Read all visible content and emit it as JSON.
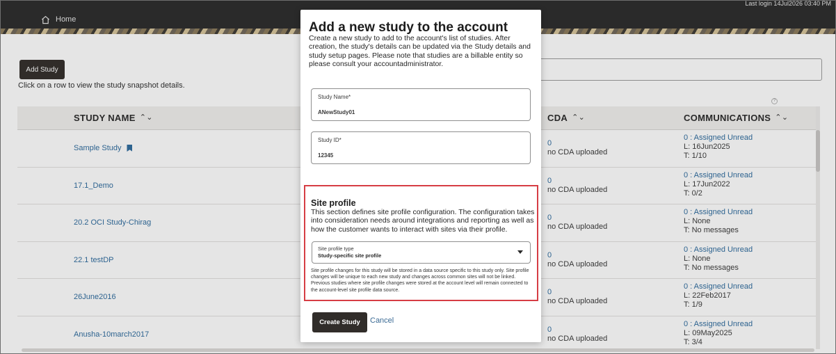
{
  "header": {
    "home_label": "Home",
    "last_login": "Last login 14Jul2026 03:40 PM"
  },
  "page": {
    "add_study_label": "Add Study",
    "hint": "Click on a row to view the study snapshot details.",
    "help": "?"
  },
  "table": {
    "columns": {
      "study_name": "STUDY NAME",
      "cda": "CDA",
      "communications": "COMMUNICATIONS"
    },
    "sort_glyph": "⌃⌄",
    "rows": [
      {
        "name": "Sample Study",
        "bookmarked": true,
        "cda_count": "0",
        "cda_text": "no CDA uploaded",
        "comm_link": "0 : Assigned Unread",
        "comm_l": "L: 16Jun2025",
        "comm_t": "T: 1/10"
      },
      {
        "name": "17.1_Demo",
        "bookmarked": false,
        "cda_count": "0",
        "cda_text": "no CDA uploaded",
        "comm_link": "0 : Assigned Unread",
        "comm_l": "L: 17Jun2022",
        "comm_t": "T: 0/2"
      },
      {
        "name": "20.2 OCI Study-Chirag",
        "bookmarked": false,
        "cda_count": "0",
        "cda_text": "no CDA uploaded",
        "comm_link": "0 : Assigned Unread",
        "comm_l": "L: None",
        "comm_t": "T: No messages"
      },
      {
        "name": "22.1 testDP",
        "bookmarked": false,
        "cda_count": "0",
        "cda_text": "no CDA uploaded",
        "comm_link": "0 : Assigned Unread",
        "comm_l": "L: None",
        "comm_t": "T: No messages"
      },
      {
        "name": "26June2016",
        "bookmarked": false,
        "cda_count": "0",
        "cda_text": "no CDA uploaded",
        "comm_link": "0 : Assigned Unread",
        "comm_l": "L: 22Feb2017",
        "comm_t": "T: 1/9"
      },
      {
        "name": "Anusha-10march2017",
        "bookmarked": false,
        "cda_count": "0",
        "cda_text": "no CDA uploaded",
        "comm_link": "0 : Assigned Unread",
        "comm_l": "L: 09May2025",
        "comm_t": "T: 3/4"
      }
    ]
  },
  "modal": {
    "title": "Add a new study to the account",
    "description": "Create a new study to add to the account's list of studies. After creation, the study's details can be updated via the Study details and study setup pages. Please note that studies are a billable entity so please consult your accountadministrator.",
    "study_name": {
      "label": "Study Name*",
      "value": "ANewStudy01"
    },
    "study_id": {
      "label": "Study ID*",
      "value": "12345"
    },
    "site_profile": {
      "title": "Site profile",
      "description": "This section defines site profile configuration. The configuration takes into consideration needs around integrations and reporting as well as how the customer wants to interact with sites via their profile.",
      "select_label": "Site profile type",
      "select_value": "Study-specific site profile",
      "note": "Site profile changes for this study will be stored in a data source specific to this study only. Site profile changes will be unique to each new study and changes across common sites will not be linked. Previous studies where site profile changes were stored at the account level will remain connected to the account-level site profile data source."
    },
    "create_label": "Create Study",
    "cancel_label": "Cancel"
  },
  "colors": {
    "accent_link": "#2e6b9e",
    "primary_button": "#312d2a",
    "highlight_border": "#d63d44"
  }
}
